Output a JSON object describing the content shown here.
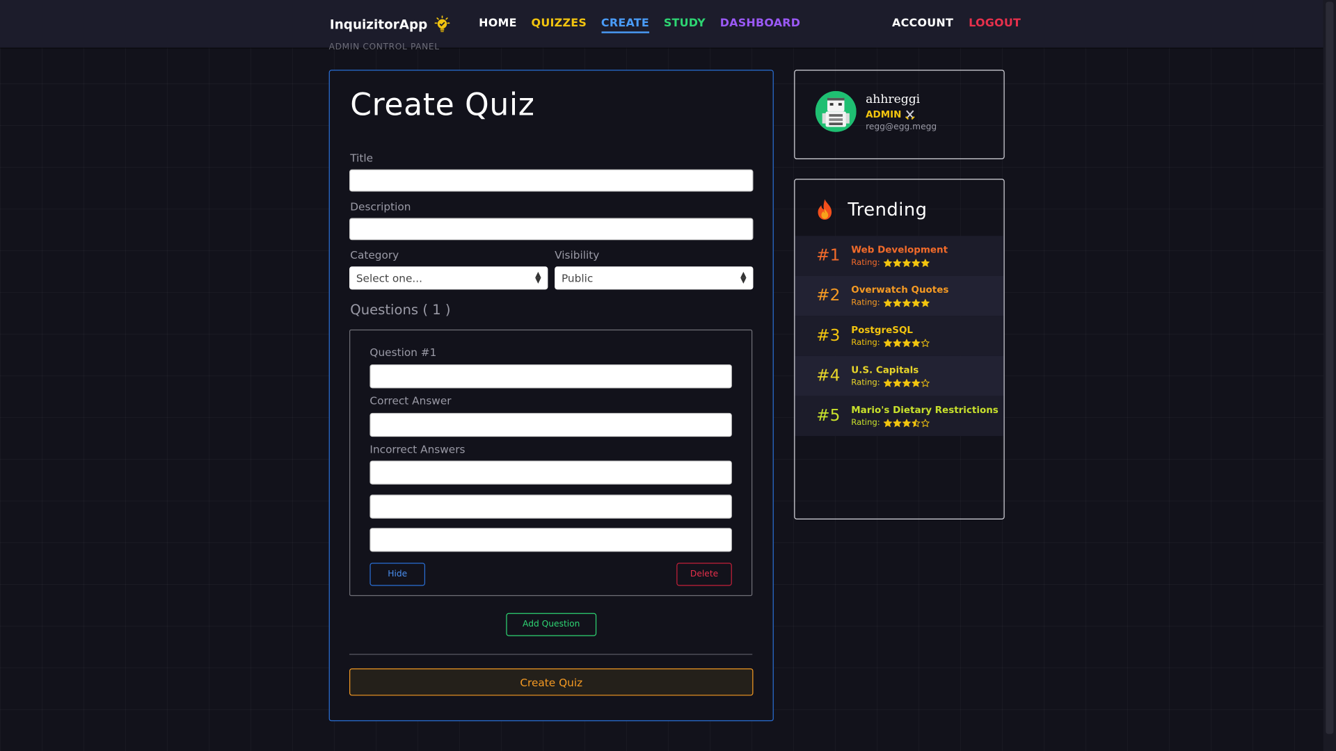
{
  "colors": {
    "background": "#12121b",
    "navbar": "#1c1c2b",
    "home": "#ffffff",
    "quizzes": "#f2c40f",
    "create": "#4a9cf8",
    "study": "#2ed573",
    "dashboard": "#9b59f6",
    "logout": "#e8304c",
    "accent_border": "#2a6fd6",
    "star": "#f2c40f"
  },
  "nav": {
    "brand": "InquizitorApp",
    "links": [
      "HOME",
      "QUIZZES",
      "CREATE",
      "STUDY",
      "DASHBOARD"
    ],
    "active": "CREATE",
    "account": "ACCOUNT",
    "logout": "LOGOUT"
  },
  "admin_panel_label": "ADMIN CONTROL PANEL",
  "form": {
    "title": "Create Quiz",
    "title_label": "Title",
    "title_value": "",
    "description_label": "Description",
    "description_value": "",
    "category_label": "Category",
    "category_value": "Select one...",
    "visibility_label": "Visibility",
    "visibility_value": "Public",
    "questions_heading": "Questions ( 1 )",
    "question": {
      "label": "Question #1",
      "value": "",
      "correct_label": "Correct Answer",
      "correct_value": "",
      "incorrect_label": "Incorrect Answers",
      "incorrect_values": [
        "",
        "",
        ""
      ],
      "hide_button": "Hide",
      "delete_button": "Delete"
    },
    "add_question_button": "Add Question",
    "submit_button": "Create Quiz"
  },
  "profile": {
    "username": "ahhreggi",
    "role": "ADMIN",
    "email": "regg@egg.megg"
  },
  "trending": {
    "title": "Trending",
    "rating_label": "Rating:",
    "items": [
      {
        "rank": "#1",
        "name": "Web Development",
        "rating": 5,
        "color": "#f26b2a",
        "bg": "#1c1c2a"
      },
      {
        "rank": "#2",
        "name": "Overwatch Quotes",
        "rating": 5,
        "color": "#f59a23",
        "bg": "#222233"
      },
      {
        "rank": "#3",
        "name": "PostgreSQL",
        "rating": 4,
        "color": "#f2c40f",
        "bg": "#1c1c2a"
      },
      {
        "rank": "#4",
        "name": "U.S. Capitals",
        "rating": 4,
        "color": "#e8d52a",
        "bg": "#222233"
      },
      {
        "rank": "#5",
        "name": "Mario's Dietary Restrictions",
        "rating": 3.5,
        "color": "#c8e02c",
        "bg": "#1c1c2a"
      }
    ]
  }
}
